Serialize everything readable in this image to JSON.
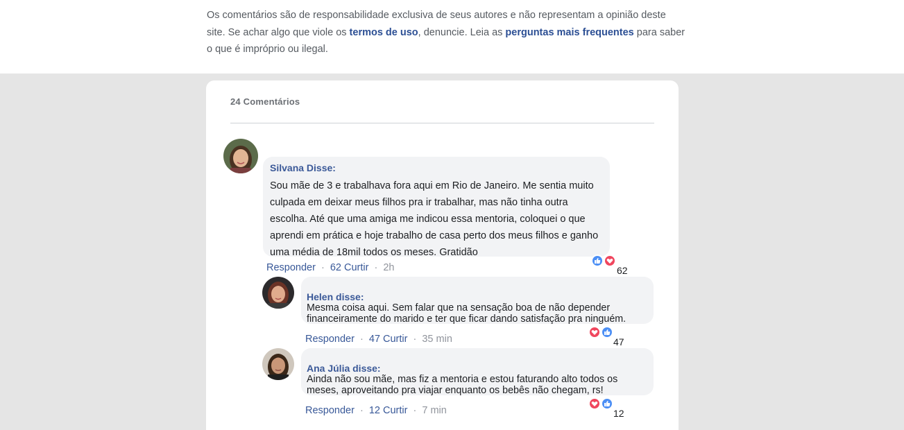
{
  "notice": {
    "part1": "Os comentários são de responsabilidade exclusiva de seus autores e não representam a opinião deste site. Se achar algo que viole os ",
    "terms_link": "termos de uso",
    "part2": ", denuncie. Leia as ",
    "faq_link": "perguntas mais frequentes",
    "part3": " para saber o que é impróprio ou ilegal."
  },
  "comments_header": {
    "count_label": "24 Comentários"
  },
  "comments": [
    {
      "author": "Silvana Disse:",
      "text": "Sou mãe de 3 e trabalhava fora aqui em Rio de Janeiro. Me sentia muito culpada em deixar meus filhos pra ir trabalhar, mas não tinha outra escolha. Até que uma amiga me indicou essa mentoria, coloquei o que aprendi em prática e hoje trabalho de casa perto dos meus filhos e ganho uma média de 18mil todos os meses. Gratidão",
      "reply_label": "Responder",
      "like_label": "62 Curtir",
      "time": "2h",
      "reaction_count": "62",
      "reactions": [
        "like-icon",
        "heart-icon"
      ]
    },
    {
      "author": "Helen disse:",
      "text": "Mesma coisa aqui. Sem falar que na sensação boa de não depender financeiramente do marido e ter que ficar dando satisfação pra ninguém.",
      "reply_label": "Responder",
      "like_label": "47 Curtir",
      "time": "35 min",
      "reaction_count": "47",
      "reactions": [
        "heart-icon",
        "like-icon"
      ]
    },
    {
      "author": "Ana Júlia disse:",
      "text": "Ainda não sou mãe, mas fiz a mentoria e estou faturando alto todos os meses, aproveitando pra viajar enquanto os bebês não chegam, rs!",
      "reply_label": "Responder",
      "like_label": "12 Curtir",
      "time": "7 min",
      "reaction_count": "12",
      "reactions": [
        "heart-icon",
        "like-icon"
      ]
    }
  ],
  "separator": "·",
  "colors": {
    "link": "#3b5998",
    "like": "#4c8ff5",
    "love": "#f0465e",
    "bubble": "#f2f3f5"
  }
}
